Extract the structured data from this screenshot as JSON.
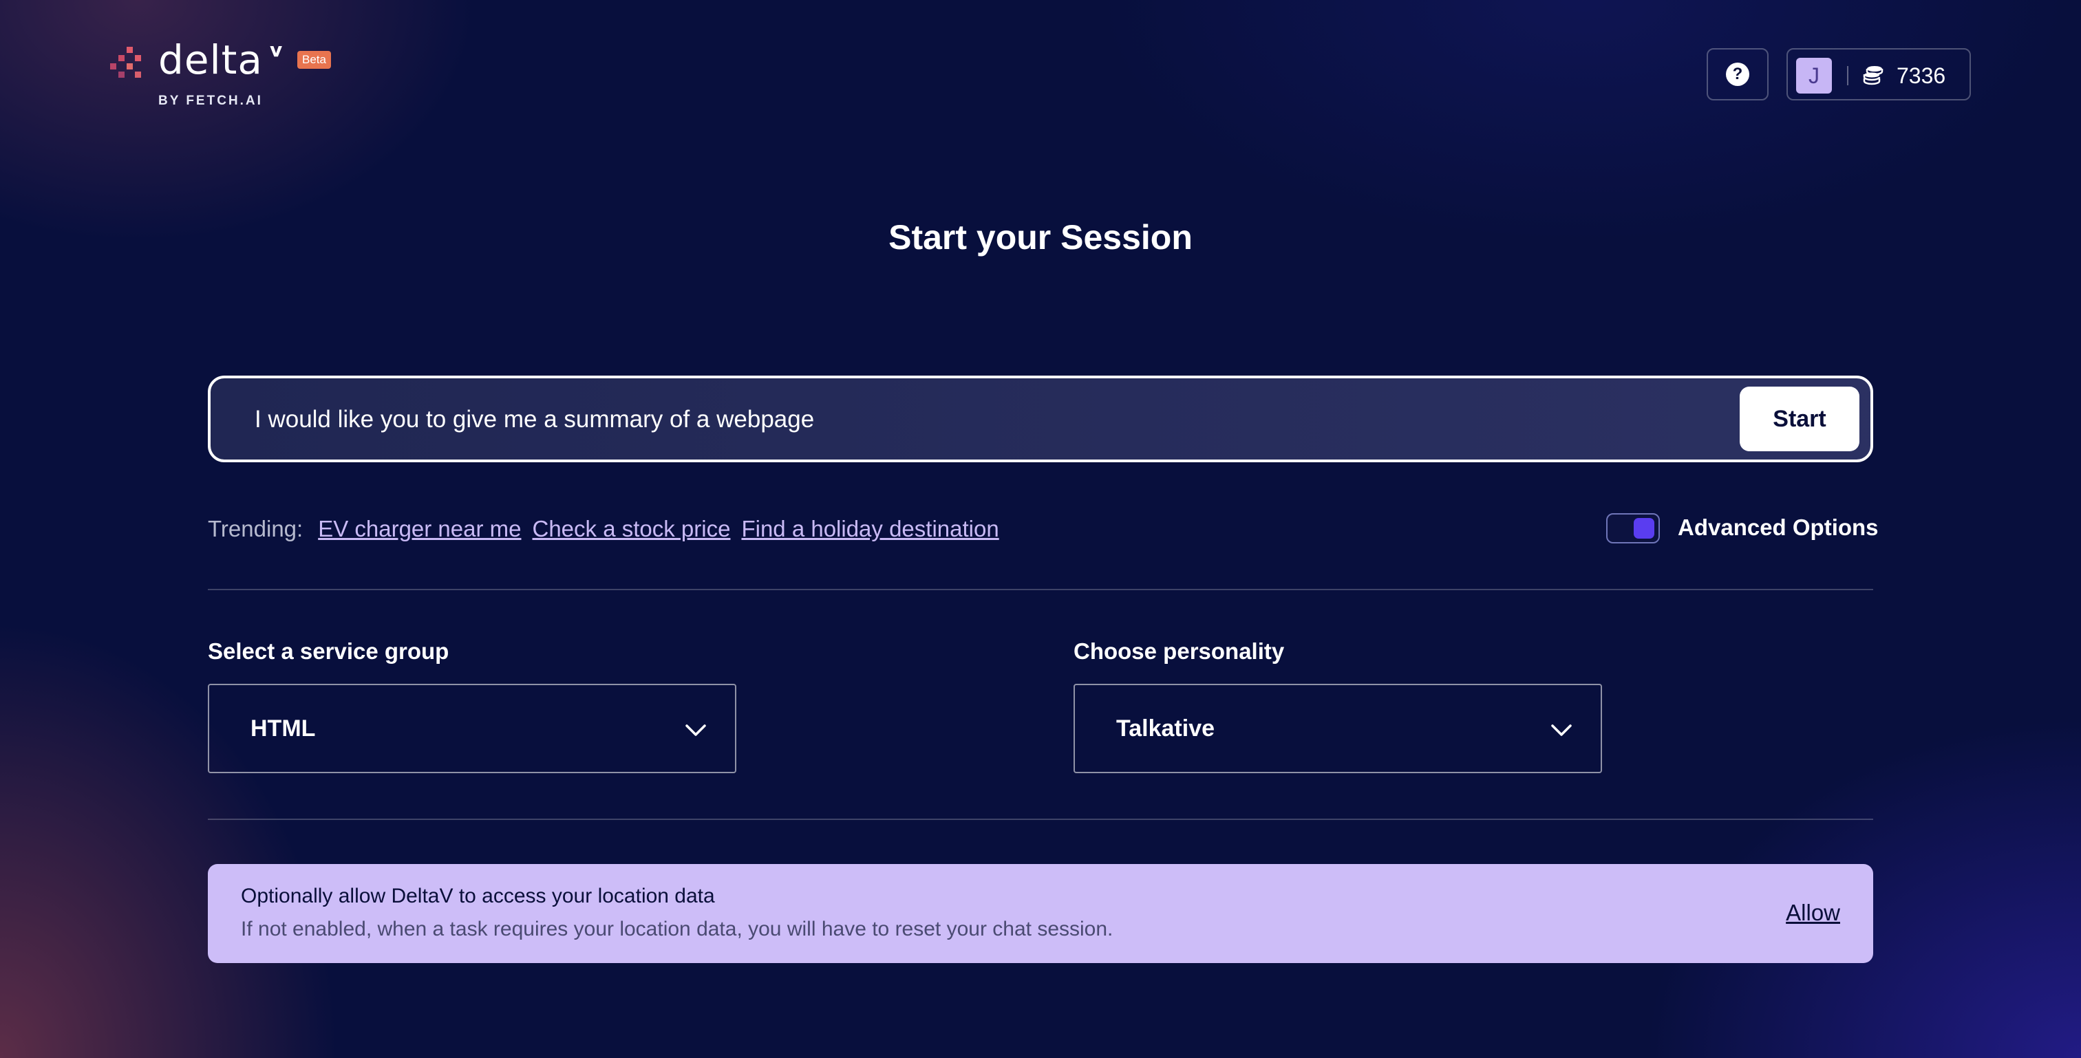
{
  "header": {
    "logo_text": "delta",
    "logo_superscript": "v",
    "beta_badge": "Beta",
    "byline": "BY FETCH.AI",
    "help_icon": "question-circle-icon",
    "help_glyph": "?",
    "avatar_initial": "J",
    "credits_icon": "coin-stack-icon",
    "credits": "7336"
  },
  "main": {
    "title": "Start your Session",
    "prompt": {
      "value": "I would like you to give me a summary of a webpage",
      "start_label": "Start"
    },
    "trending": {
      "label": "Trending:",
      "items": [
        "EV charger near me",
        "Check a stock price",
        "Find a holiday destination"
      ]
    },
    "advanced_options": {
      "label": "Advanced Options",
      "enabled": true
    },
    "service_group": {
      "label": "Select a service group",
      "value": "HTML"
    },
    "personality": {
      "label": "Choose personality",
      "value": "Talkative"
    },
    "location_banner": {
      "title": "Optionally allow DeltaV to access your location data",
      "description": "If not enabled, when a task requires your location data, you will have to reset your chat session.",
      "allow_label": "Allow"
    }
  },
  "colors": {
    "background": "#080f3d",
    "accent": "#5a3df0",
    "banner": "#cdbdf8",
    "beta": "#e8744f",
    "logo_dots": "#e05a6b"
  }
}
